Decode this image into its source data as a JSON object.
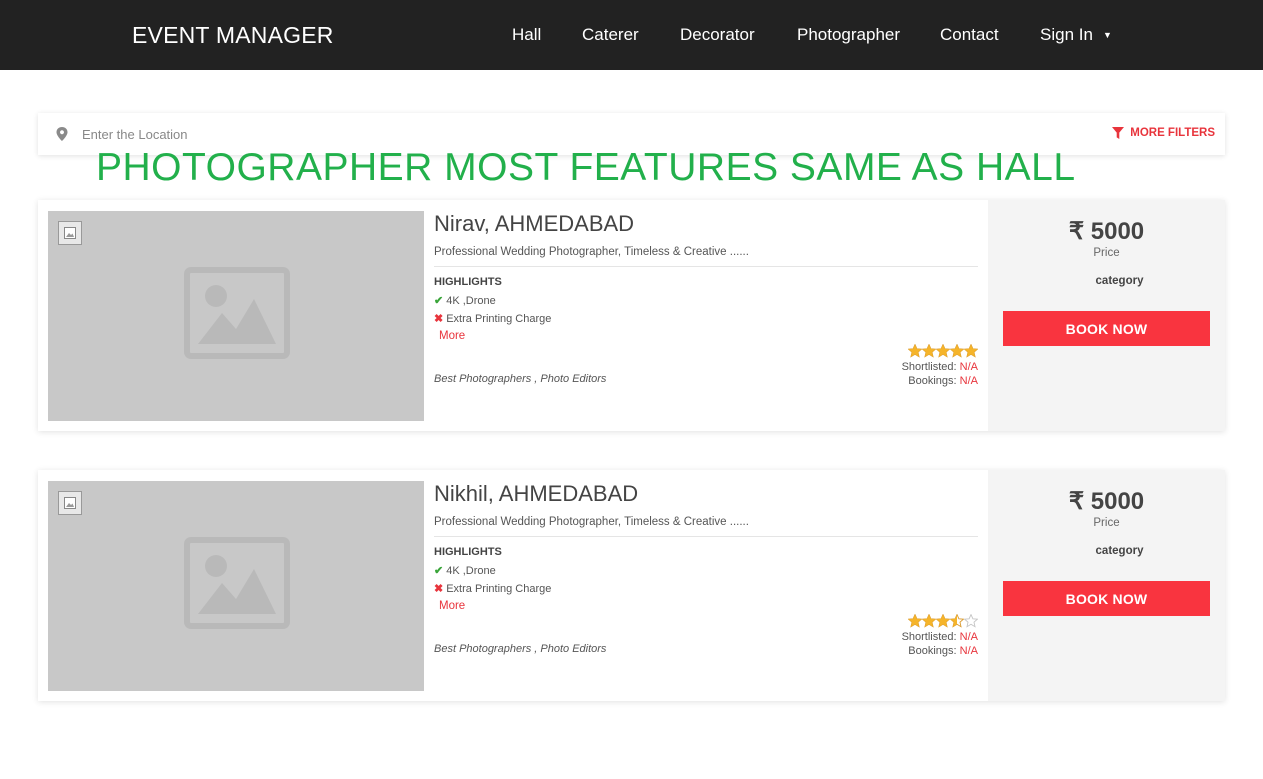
{
  "navbar": {
    "brand": "EVENT MANAGER",
    "items": [
      {
        "label": "Hall"
      },
      {
        "label": "Caterer"
      },
      {
        "label": "Decorator"
      },
      {
        "label": "Photographer"
      },
      {
        "label": "Contact"
      },
      {
        "label": "Sign In",
        "caret": "▼"
      }
    ]
  },
  "search": {
    "placeholder": "Enter the Location",
    "value": "",
    "location_icon": "map-pin-icon",
    "filter_icon": "funnel-icon",
    "more_filters_label": "MORE FILTERS"
  },
  "overlay_heading": "PHOTOGRAPHER MOST FEATURES SAME AS HALL",
  "colors": {
    "navbar_bg": "#222222",
    "accent_red": "#f9343f",
    "heading_green": "#22b04b",
    "star_gold": "#f5b42a"
  },
  "listings": [
    {
      "title": "Nirav, AHMEDABAD",
      "subtitle": "Professional Wedding Photographer, Timeless & Creative ......",
      "highlights_title": "HIGHLIGHTS",
      "highlight_yes": "4K ,Drone",
      "highlight_no": "Extra Printing Charge",
      "more_label": "More",
      "tags": "Best Photographers , Photo Editors",
      "rating": 5,
      "shortlisted_label": "Shortlisted:",
      "shortlisted_value": "N/A",
      "bookings_label": "Bookings:",
      "bookings_value": "N/A",
      "price": "₹ 5000",
      "price_label": "Price",
      "category": "category",
      "book_label": "BOOK NOW"
    },
    {
      "title": "Nikhil, AHMEDABAD",
      "subtitle": "Professional Wedding Photographer, Timeless & Creative ......",
      "highlights_title": "HIGHLIGHTS",
      "highlight_yes": "4K ,Drone",
      "highlight_no": "Extra Printing Charge",
      "more_label": "More",
      "tags": "Best Photographers , Photo Editors",
      "rating": 3.5,
      "shortlisted_label": "Shortlisted:",
      "shortlisted_value": "N/A",
      "bookings_label": "Bookings:",
      "bookings_value": "N/A",
      "price": "₹ 5000",
      "price_label": "Price",
      "category": "category",
      "book_label": "BOOK NOW"
    }
  ]
}
